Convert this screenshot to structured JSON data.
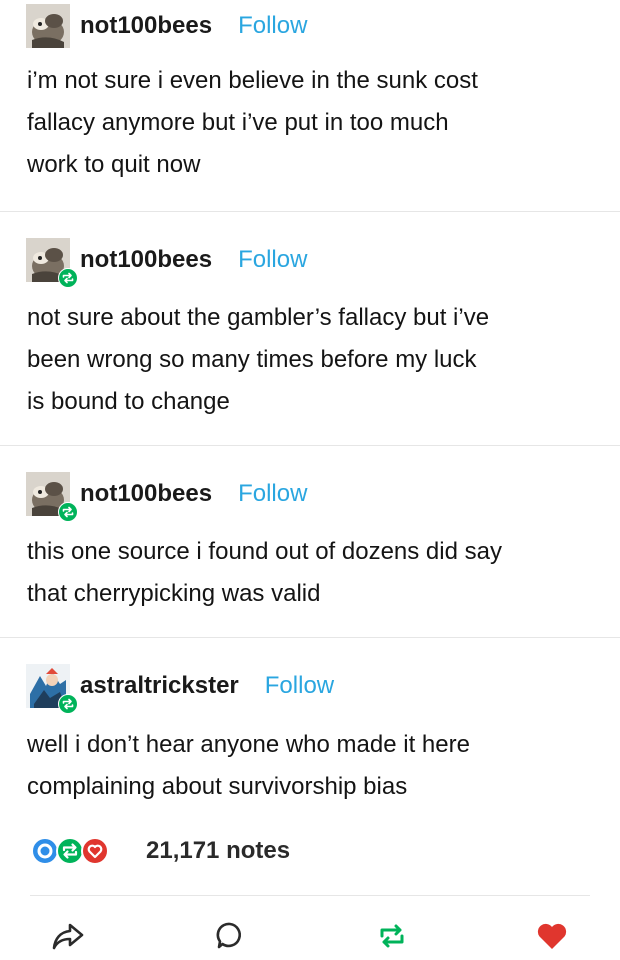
{
  "posts": [
    {
      "username": "not100bees",
      "follow": "Follow",
      "reblog": false,
      "avatar": "gremlin-avatar",
      "lines": [
        "i’m not sure i even believe in the sunk cost",
        "fallacy anymore but i’ve put in too much",
        "work to quit now"
      ]
    },
    {
      "username": "not100bees",
      "follow": "Follow",
      "reblog": true,
      "avatar": "gremlin-avatar",
      "lines": [
        "not sure about the gambler’s fallacy but i’ve",
        "been wrong so many times before my luck",
        "is bound to change"
      ]
    },
    {
      "username": "not100bees",
      "follow": "Follow",
      "reblog": true,
      "avatar": "gremlin-avatar",
      "lines": [
        "this one source i found out of dozens did say",
        "that cherrypicking was valid"
      ]
    },
    {
      "username": "astraltrickster",
      "follow": "Follow",
      "reblog": true,
      "avatar": "character-avatar",
      "lines": [
        "well i don’t hear anyone who made it here",
        "complaining about survivorship bias"
      ]
    }
  ],
  "notes": {
    "count": "21,171 notes",
    "icons": [
      "reply-note-icon",
      "reblog-note-icon",
      "like-note-icon"
    ]
  },
  "actions": {
    "icons": [
      "share-icon",
      "reply-icon",
      "reblog-icon",
      "like-icon"
    ]
  },
  "colors": {
    "follow_blue": "#2aa6e0",
    "reblog_green": "#00b35a",
    "like_red": "#e0362e",
    "reply_blue": "#2f8ee8"
  }
}
